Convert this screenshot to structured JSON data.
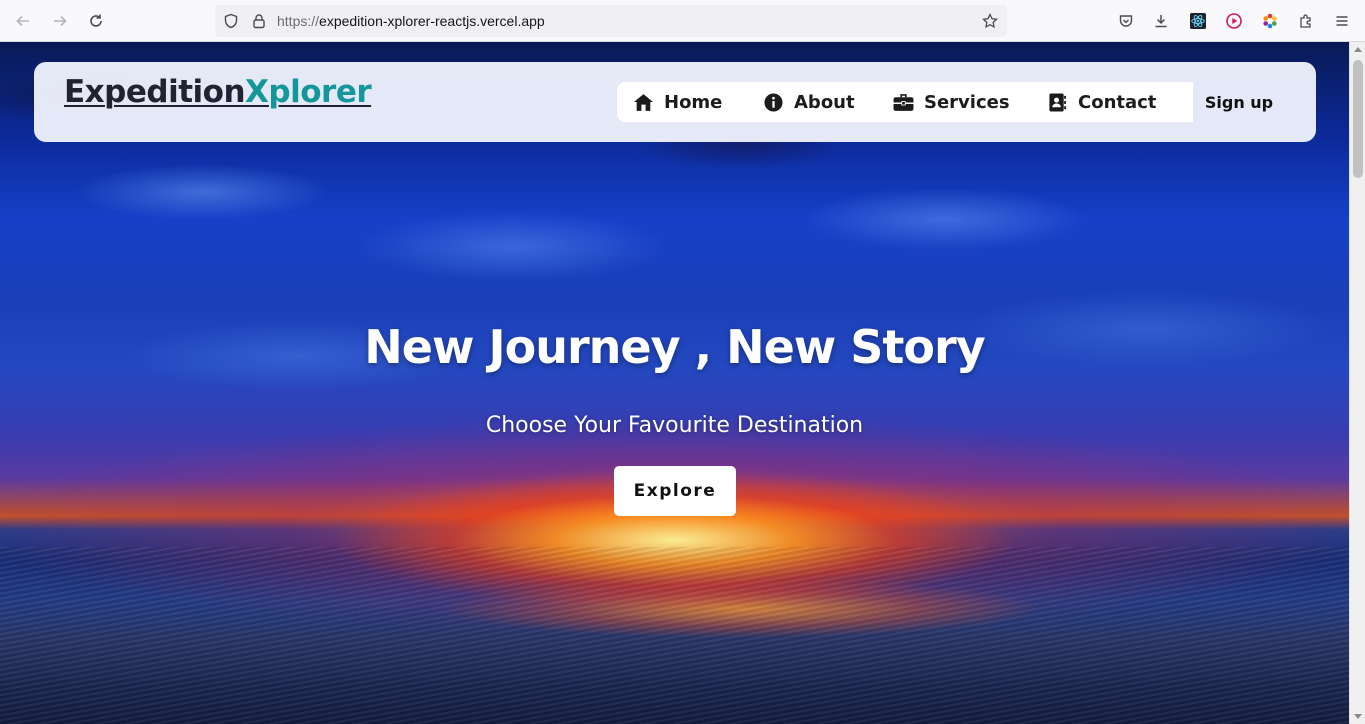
{
  "browser": {
    "url_scheme": "https://",
    "url_host": "expedition-xplorer-reactjs.vercel.app",
    "icons": {
      "back": "back-arrow-icon",
      "forward": "forward-arrow-icon",
      "reload": "reload-icon",
      "shield": "tracking-protection-icon",
      "lock": "lock-icon",
      "bookmark": "star-icon",
      "pocket": "pocket-icon",
      "downloads": "download-icon",
      "react_devtools": "react-icon",
      "media": "play-icon",
      "color_picker": "color-wheel-icon",
      "extensions": "puzzle-icon",
      "menu": "hamburger-menu-icon"
    }
  },
  "navbar": {
    "logo_primary": "Expedition",
    "logo_accent": "Xplorer",
    "logo_accent_color": "#13979a",
    "links": [
      {
        "label": "Home",
        "icon": "house-icon"
      },
      {
        "label": "About",
        "icon": "info-circle-icon"
      },
      {
        "label": "Services",
        "icon": "briefcase-icon"
      },
      {
        "label": "Contact",
        "icon": "address-card-icon"
      }
    ],
    "signup_label": "Sign up"
  },
  "hero": {
    "title": "New Journey , New Story",
    "subtitle": "Choose Your Favourite Destination",
    "cta_label": "Explore"
  }
}
